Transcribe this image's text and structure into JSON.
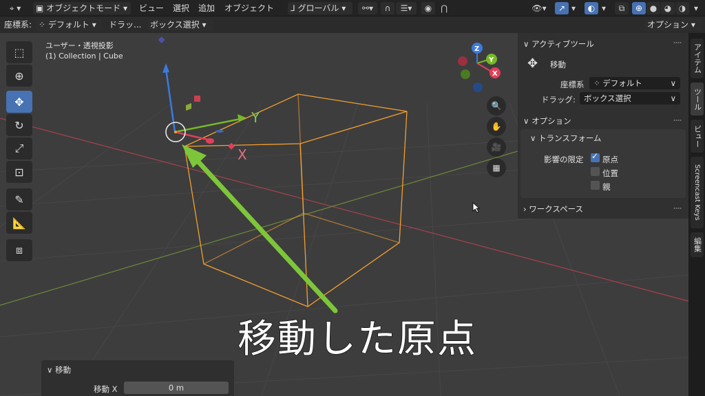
{
  "header": {
    "mode": "オブジェクトモード",
    "menus": [
      "ビュー",
      "選択",
      "追加",
      "オブジェクト"
    ],
    "transform_orientation": "グローバル"
  },
  "toolbar2": {
    "coord_label": "座標系:",
    "coord_value": "デフォルト",
    "drag_label": "ドラッ...",
    "drag_value": "ボックス選択",
    "options_label": "オプション"
  },
  "viewport": {
    "view_name": "ユーザー・透視投影",
    "collection_info": "(1) Collection | Cube",
    "axis_labels": {
      "x": "X",
      "y": "Y",
      "z": "Z"
    },
    "caption": "移動した原点"
  },
  "panel": {
    "active_tool_title": "アクティブツール",
    "tool_name": "移動",
    "coord_label": "座標系",
    "coord_value": "デフォルト",
    "drag_label": "ドラッグ:",
    "drag_value": "ボックス選択",
    "options_title": "オプション",
    "transform_title": "トランスフォーム",
    "affect_label": "影響の限定",
    "checks": [
      {
        "label": "原点",
        "checked": true
      },
      {
        "label": "位置",
        "checked": false
      },
      {
        "label": "親",
        "checked": false
      }
    ],
    "workspace_title": "ワークスペース"
  },
  "sidetabs": [
    "アイテム",
    "ツール",
    "ビュー",
    "Screencast Keys",
    "編集"
  ],
  "operator": {
    "title": "移動",
    "field_label": "移動 X",
    "field_value": "0 m"
  },
  "colors": {
    "selection_orange": "#f5a030",
    "x_red": "#e0405a",
    "y_green": "#76b828",
    "z_blue": "#3a7be0",
    "annotation_arrow": "#7dc63a",
    "active_blue": "#4772b3"
  }
}
